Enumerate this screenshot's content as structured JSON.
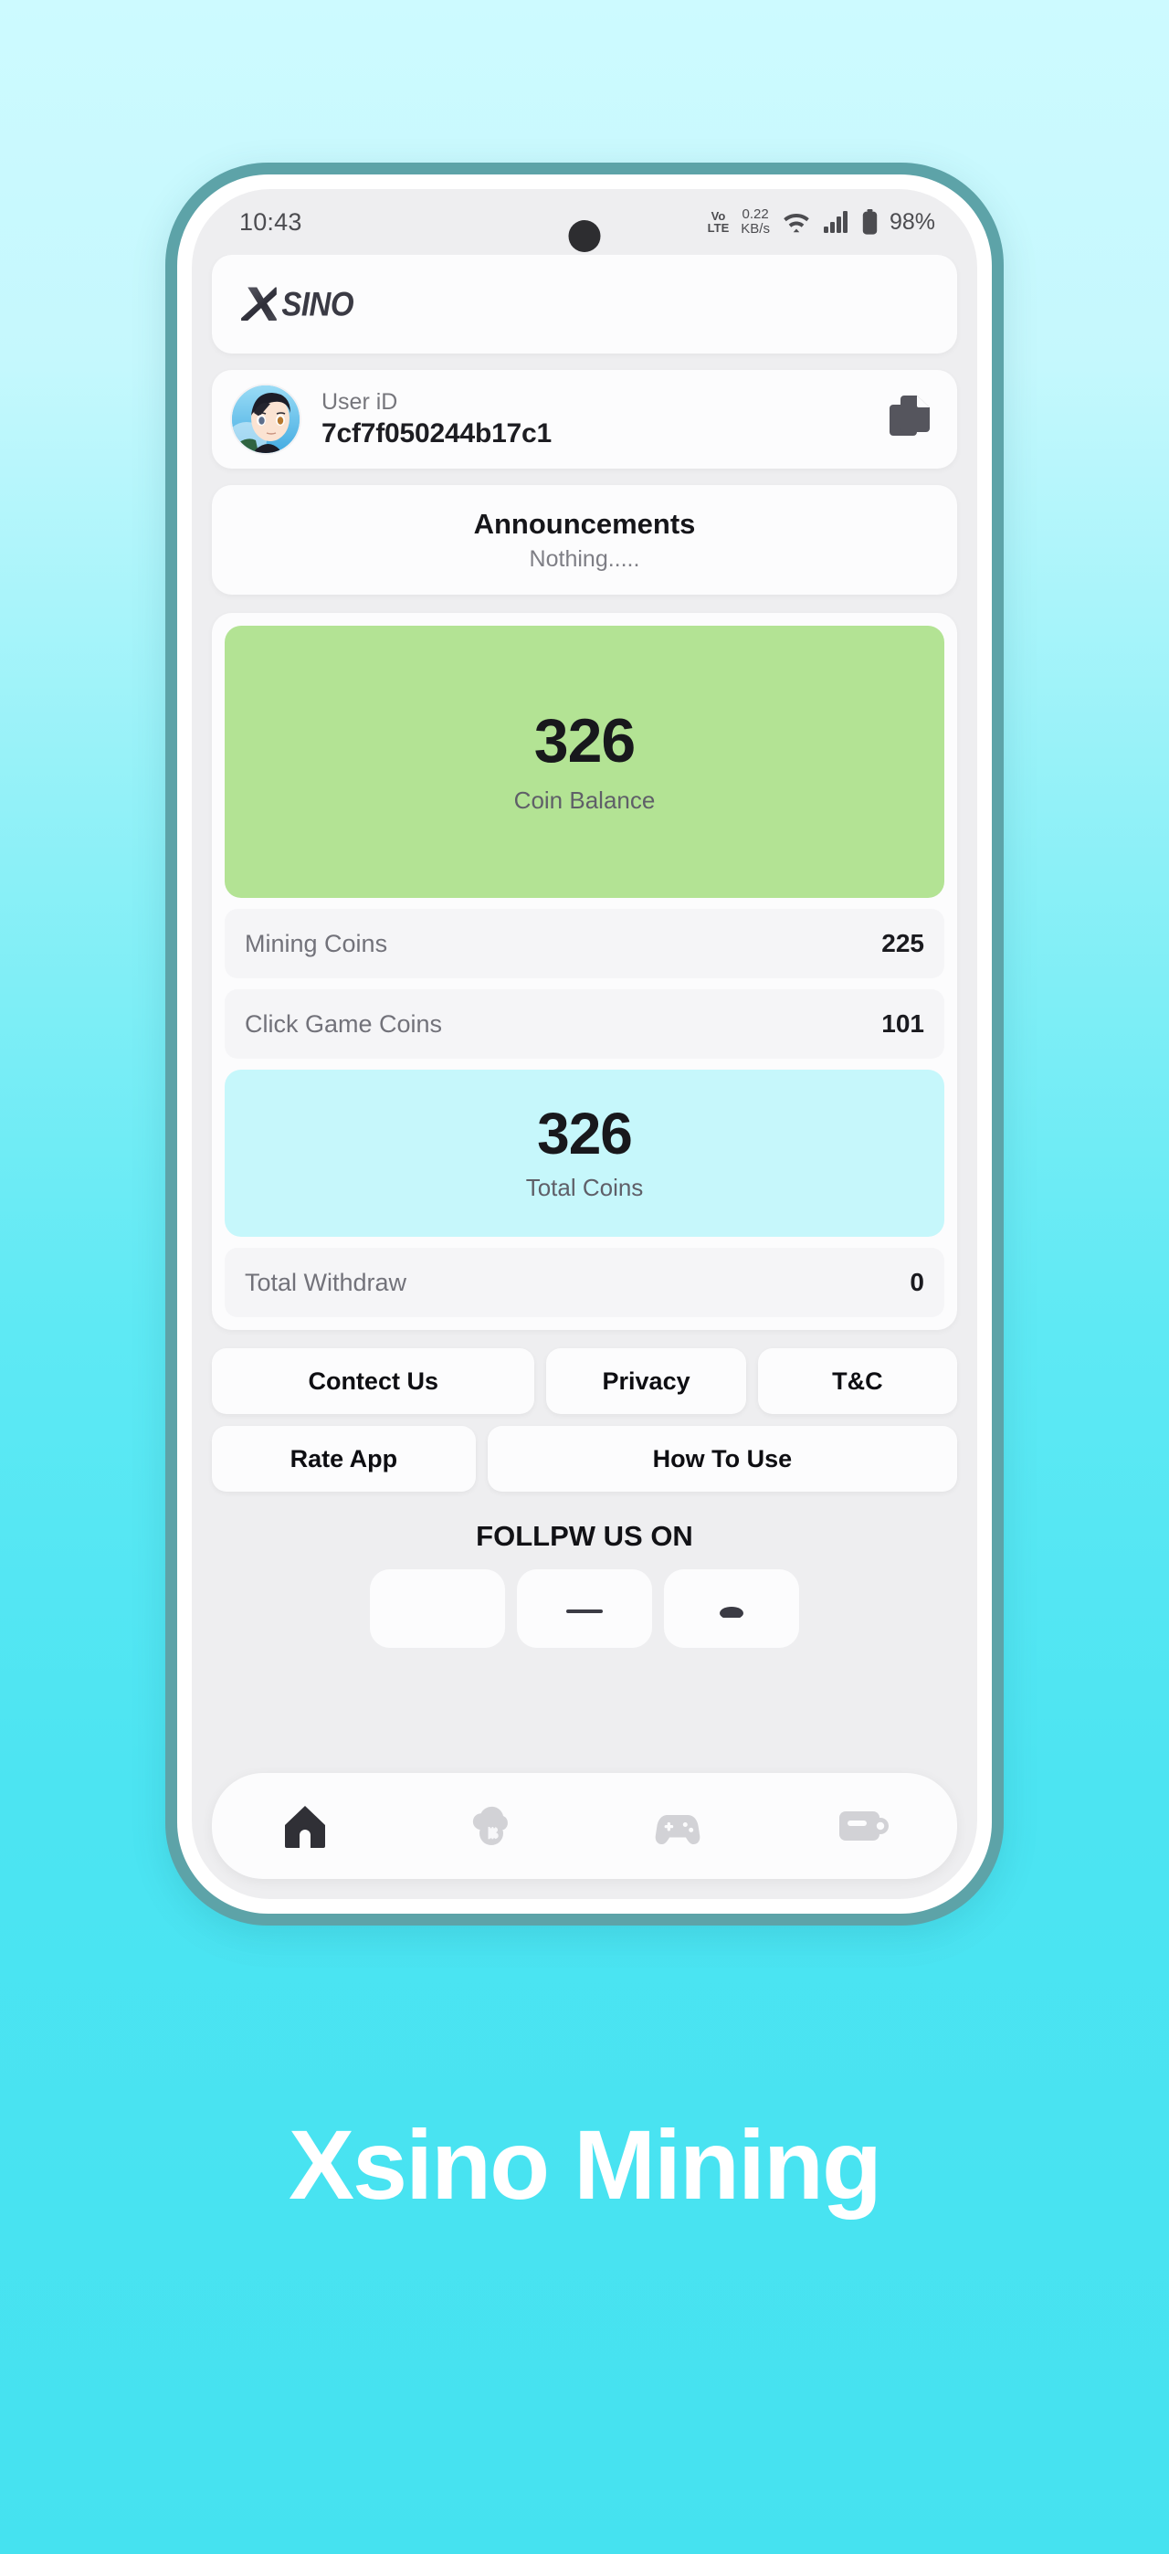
{
  "status_bar": {
    "time": "10:43",
    "volte_line1": "Vo",
    "volte_line2": "LTE",
    "net_speed_value": "0.22",
    "net_speed_unit": "KB/s",
    "battery_percent": "98%",
    "wifi_icon": "wifi-icon",
    "signal_icon": "cellular-signal-icon",
    "battery_icon": "battery-icon"
  },
  "app_bar": {
    "logo_mark": "X",
    "logo_word": "SINO",
    "logo_name": "xsino-logo"
  },
  "user_card": {
    "label": "User iD",
    "value": "7cf7f050244b17c1",
    "avatar_name": "user-avatar",
    "copy_icon": "copy-icon"
  },
  "announcements": {
    "title": "Announcements",
    "body": "Nothing....."
  },
  "balance": {
    "coin_balance_value": "326",
    "coin_balance_label": "Coin Balance",
    "coin_balance_color": "#b3e394",
    "total_coins_value": "326",
    "total_coins_label": "Total Coins",
    "total_coins_color": "#c6f7fb",
    "rows": [
      {
        "label": "Mining Coins",
        "value": "225"
      },
      {
        "label": "Click Game Coins",
        "value": "101"
      },
      {
        "label": "Total Withdraw",
        "value": "0"
      }
    ]
  },
  "links": {
    "contact": "Contect Us",
    "privacy": "Privacy",
    "tc": "T&C",
    "rate": "Rate App",
    "how_to_use": "How To Use"
  },
  "follow": {
    "title": "FOLLPW US ON"
  },
  "bottom_nav": {
    "items": [
      {
        "icon": "home-icon",
        "active": true
      },
      {
        "icon": "cloud-bitcoin-mining-icon",
        "active": false
      },
      {
        "icon": "gamepad-icon",
        "active": false
      },
      {
        "icon": "wallet-icon",
        "active": false
      }
    ],
    "active_color": "#303036",
    "inactive_color": "#d2d2d6"
  },
  "hero": {
    "title": "Xsino Mining"
  }
}
